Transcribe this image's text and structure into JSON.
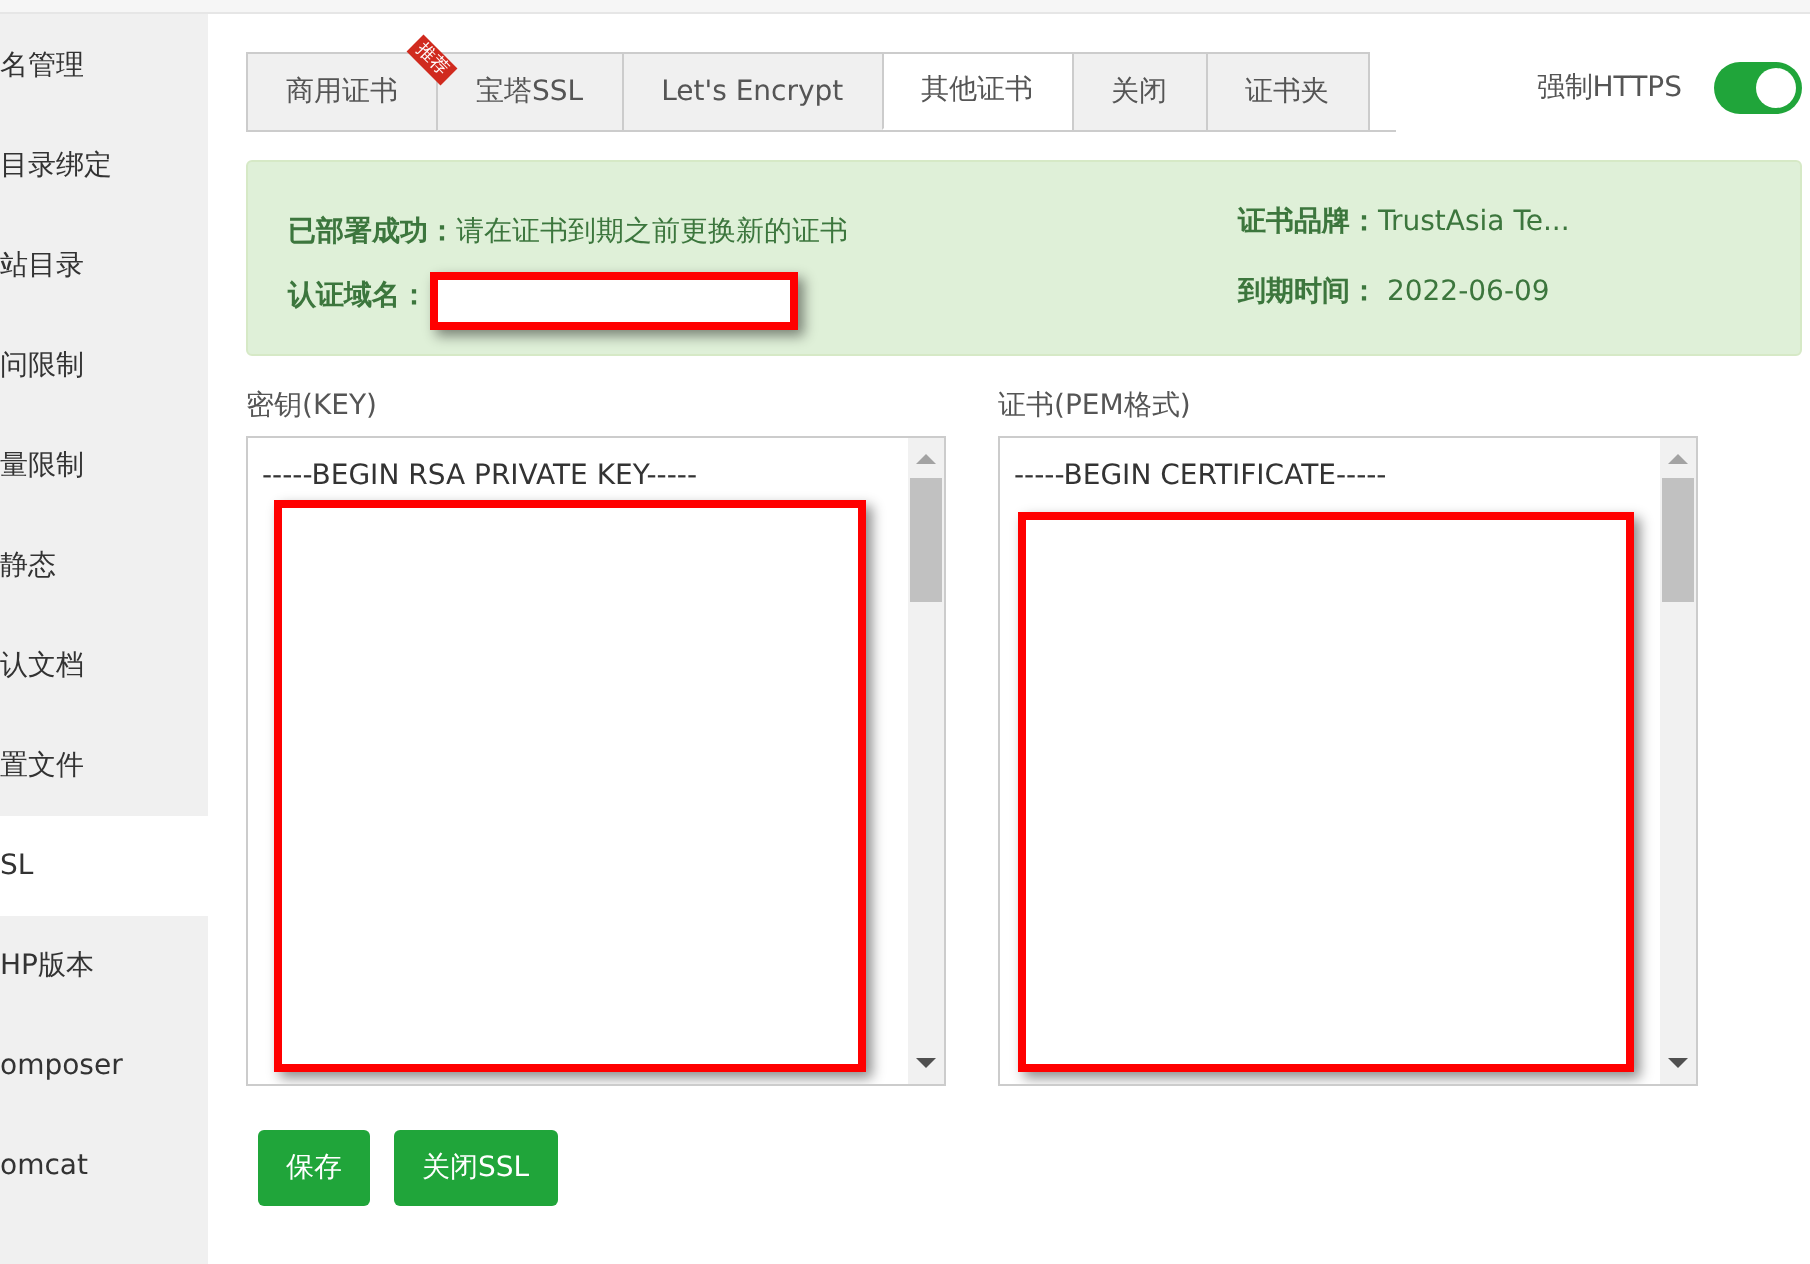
{
  "sidebar": {
    "items": [
      {
        "label": "名管理",
        "selected": false
      },
      {
        "label": "目录绑定",
        "selected": false
      },
      {
        "label": "站目录",
        "selected": false
      },
      {
        "label": "问限制",
        "selected": false
      },
      {
        "label": "量限制",
        "selected": false
      },
      {
        "label": "静态",
        "selected": false
      },
      {
        "label": "认文档",
        "selected": false
      },
      {
        "label": "置文件",
        "selected": false
      },
      {
        "label": "SL",
        "selected": true
      },
      {
        "label": "HP版本",
        "selected": false
      },
      {
        "label": "omposer",
        "selected": false
      },
      {
        "label": "omcat",
        "selected": false
      }
    ]
  },
  "tabs": [
    {
      "label": "商用证书",
      "selected": false,
      "ribbon": "推荐"
    },
    {
      "label": "宝塔SSL",
      "selected": false
    },
    {
      "label": "Let's Encrypt",
      "selected": false
    },
    {
      "label": "其他证书",
      "selected": true
    },
    {
      "label": "关闭",
      "selected": false
    },
    {
      "label": "证书夹",
      "selected": false
    }
  ],
  "force_https": {
    "label": "强制HTTPS",
    "on": true
  },
  "status": {
    "deployed_label": "已部署成功：",
    "deployed_text": "请在证书到期之前更换新的证书",
    "domain_label": "认证域名：",
    "brand_label": "证书品牌：",
    "brand_value": "TrustAsia Te...",
    "expiry_label": "到期时间：",
    "expiry_value": "2022-06-09"
  },
  "key": {
    "label": "密钥(KEY)",
    "first_line": "-----BEGIN RSA PRIVATE KEY-----"
  },
  "certificate": {
    "label": "证书(PEM格式)",
    "first_line": "-----BEGIN CERTIFICATE-----"
  },
  "buttons": [
    "保存",
    "关闭SSL"
  ]
}
